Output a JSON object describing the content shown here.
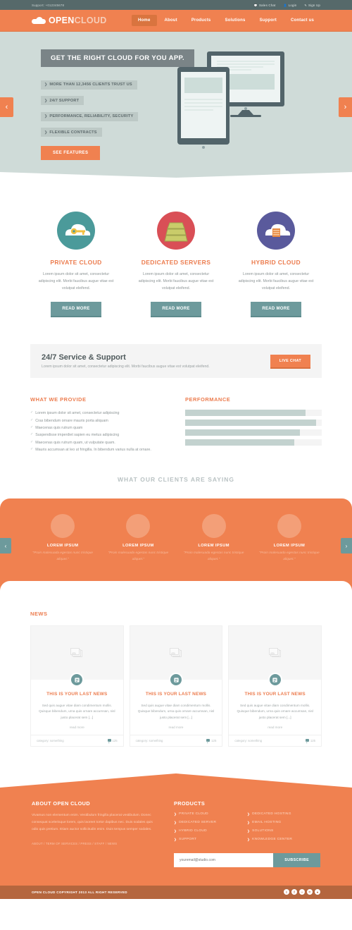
{
  "topbar": {
    "support": "Support: +012345678",
    "links": [
      {
        "icon": "chat-icon",
        "label": "Sales Chat"
      },
      {
        "icon": "user-icon",
        "label": "Login"
      },
      {
        "icon": "signup-icon",
        "label": "Sign Up"
      }
    ]
  },
  "nav": {
    "logo_primary": "OPEN",
    "logo_secondary": "CLOUD",
    "items": [
      {
        "label": "Home",
        "active": true
      },
      {
        "label": "About",
        "active": false
      },
      {
        "label": "Products",
        "active": false
      },
      {
        "label": "Solutions",
        "active": false
      },
      {
        "label": "Support",
        "active": false
      },
      {
        "label": "Contact us",
        "active": false
      }
    ]
  },
  "hero": {
    "title": "GET THE RIGHT CLOUD FOR YOU APP.",
    "bullets": [
      "MORE THAN 12,3456 CLIENTS TRUST US",
      "24/7 SUPPORT",
      "PERFORMANCE, RELIABILITY, SECURITY",
      "FLEXIBLE CONTRACTS"
    ],
    "cta": "SEE FEATURES",
    "prev": "‹",
    "next": "›"
  },
  "services": [
    {
      "title": "PRIVATE CLOUD",
      "text": "Lorem ipsum dolor sit amet, consectetur adipiscing elit. Morbi faucibus augue vitae est volutpat eleifend.",
      "button": "READ MORE",
      "icon": "cloud-key-icon",
      "color": "#4b9a9a"
    },
    {
      "title": "DEDICATED SERVERS",
      "text": "Lorem ipsum dolor sit amet, consectetur adipiscing elit. Morbi faucibus augue vitae est volutpat eleifend.",
      "button": "READ MORE",
      "icon": "server-stack-icon",
      "color": "#d94f56"
    },
    {
      "title": "HYBRID CLOUD",
      "text": "Lorem ipsum dolor sit amet, consectetur adipiscing elit. Morbi faucibus augue vitae est volutpat eleifend.",
      "button": "READ MORE",
      "icon": "cloud-server-icon",
      "color": "#5a5a9c"
    }
  ],
  "support_band": {
    "title": "24/7 Service & Support",
    "subtitle": "Lorem ipsum dolor sit amet, consectetur adipiscing elit. Morbi faucibus augue vitae est volutpat eleifend.",
    "button": "LIVE CHAT"
  },
  "provide": {
    "heading": "WHAT WE PROVIDE",
    "items": [
      "Lorem ipsum dolor sit amet, consectetur adipiscing",
      "Cras bibendum ornare mauris porta aliquam",
      "Maecenas quis rutrum quam",
      "Suspendisse imperdiet sapien eu metus adipiscing",
      "Maecenas quis rutrum quam, ut vulputate quam.",
      "Mauris accumsan at leo ut fringilla. In bibendum varius nulla at ornare."
    ]
  },
  "performance": {
    "heading": "PERFORMANCE",
    "bars": [
      88,
      96,
      84,
      80
    ]
  },
  "testimonials": {
    "heading": "WHAT OUR CLIENTS ARE SAYING",
    "prev": "‹",
    "next": "›",
    "items": [
      {
        "name": "LOREM IPSUM",
        "quote": "\"Proin malesuada egestas nunc tristique aliquet.\""
      },
      {
        "name": "LOREM IPSUM",
        "quote": "\"Proin malesuada egestas nunc tristique aliquet.\""
      },
      {
        "name": "LOREM IPSUM",
        "quote": "\"Proin malesuada egestas nunc tristique aliquet.\""
      },
      {
        "name": "LOREM IPSUM",
        "quote": "\"Proin malesuada egestas nunc tristique aliquet.\""
      }
    ]
  },
  "news": {
    "heading": "NEWS",
    "cards": [
      {
        "title": "THIS IS YOUR LAST NEWS",
        "text": "Sed quis augue vitae diam condimentum mollis. Quisque bibendum, urna quis ornare accumsan, nisl justo placerat sem [...]",
        "more": "read more",
        "category": "category: something",
        "comments": "125"
      },
      {
        "title": "THIS IS YOUR LAST NEWS",
        "text": "Sed quis augue vitae diam condimentum mollis. Quisque bibendum, urna quis ornare accumsan, nisl justo placerat sem [...]",
        "more": "read more",
        "category": "category: something",
        "comments": "125"
      },
      {
        "title": "THIS IS YOUR LAST NEWS",
        "text": "Sed quis augue vitae diam condimentum mollis. Quisque bibendum, urna quis ornare accumsan, nisl justo placerat sem [...]",
        "more": "read more",
        "category": "category: something",
        "comments": "125"
      }
    ]
  },
  "footer": {
    "about_heading": "ABOUT OPEN CLOUD",
    "about_text": "Vivamus non elementum enim. Vestibulum fringilla placerat vestibulum. Donec consequat scelerisque lorem, quis laoreet tortor dapibus nec. Duis sodales quis odio quis pretium. Etiam auctor sollicitudin enim. Duis tempus semper sodales.",
    "about_links": "ABOUT / TERM OF SERVICES / PRESS / STAFF / NEWS",
    "products_heading": "PRODUCTS",
    "products_col1": [
      "PRIVATE CLOUD",
      "DEDICATED SERVER",
      "HYBRID CLOUD",
      "SUPPORT"
    ],
    "products_col2": [
      "DEDICATED HOSTING",
      "EMAIL HOSTING",
      "SOLUTIONS",
      "KNOWLEDGE CENTER"
    ],
    "email_placeholder": "youremail@studio.com",
    "subscribe_label": "SUBSCRIBE",
    "copyright": "OPEN CLOUD COPYRIGHT 2013 ALL RIGHT RESERVED",
    "socials": [
      {
        "name": "twitter-icon",
        "glyph": "t"
      },
      {
        "name": "facebook-icon",
        "glyph": "f"
      },
      {
        "name": "flickr-icon",
        "glyph": "•"
      },
      {
        "name": "linkedin-icon",
        "glyph": "in"
      },
      {
        "name": "rss-icon",
        "glyph": "●"
      }
    ]
  },
  "colors": {
    "orange": "#f08150",
    "teal": "#6d9a9c",
    "dark": "#56696a",
    "hero_bg": "#cfdbd8",
    "copyright_bg": "#b5663e"
  }
}
